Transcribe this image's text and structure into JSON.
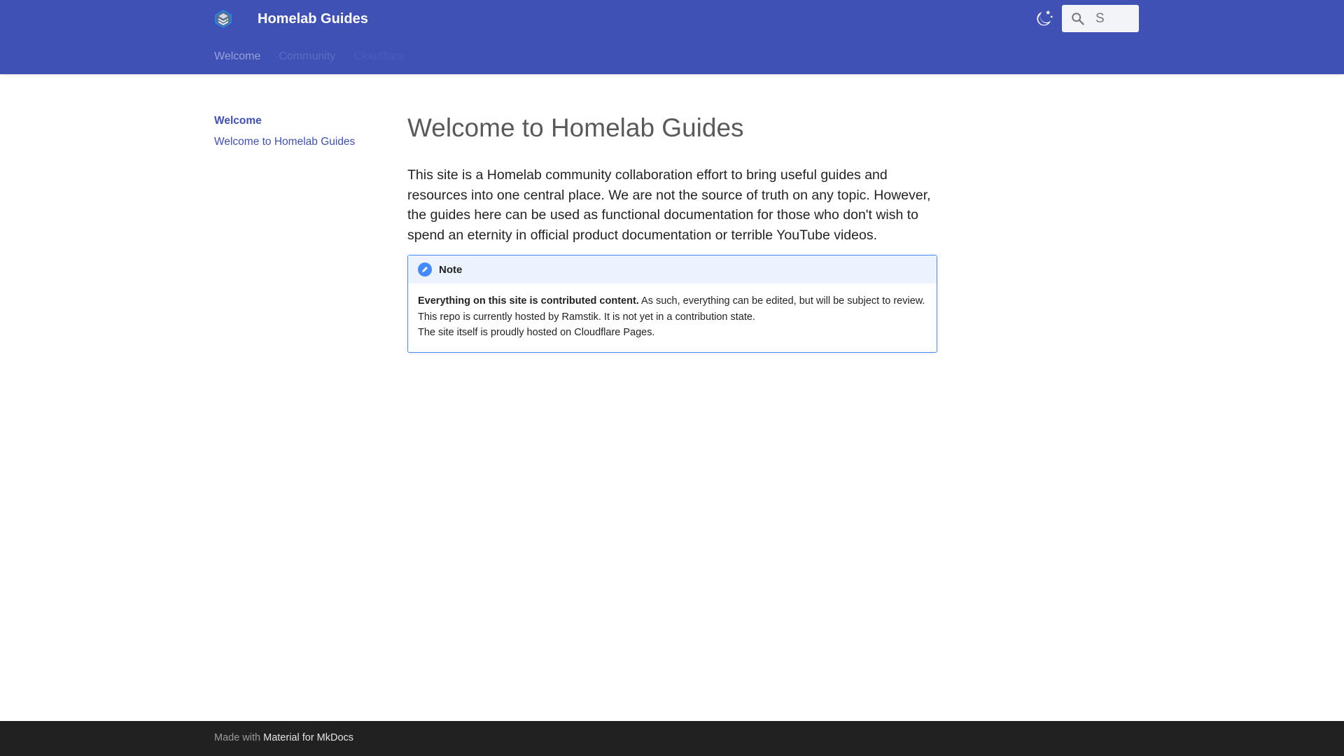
{
  "header": {
    "title": "Homelab Guides",
    "search_placeholder": "S"
  },
  "tabs": [
    {
      "label": "Welcome"
    },
    {
      "label": "Community"
    },
    {
      "label": "Cloudflare"
    }
  ],
  "sidebar": {
    "section": "Welcome",
    "items": [
      {
        "label": "Welcome to Homelab Guides"
      }
    ]
  },
  "main": {
    "title": "Welcome to Homelab Guides",
    "intro": "This site is a Homelab community collaboration effort to bring useful guides and resources into one central place. We are not the source of truth on any topic. However, the guides here can be used as functional documentation for those who don't wish to spend an eternity in official product documentation or terrible YouTube videos.",
    "note": {
      "title": "Note",
      "bold": "Everything on this site is contributed content.",
      "line1_rest": " As such, everything can be edited, but will be subject to review.",
      "line2": "This repo is currently hosted by Ramstik. It is not yet in a contribution state.",
      "line3": "The site itself is proudly hosted on Cloudflare Pages."
    }
  },
  "footer": {
    "made_with": "Made with",
    "link": "Material for MkDocs"
  },
  "colors": {
    "primary": "#3f51b5",
    "note": "#448aff",
    "footer": "#212121"
  }
}
